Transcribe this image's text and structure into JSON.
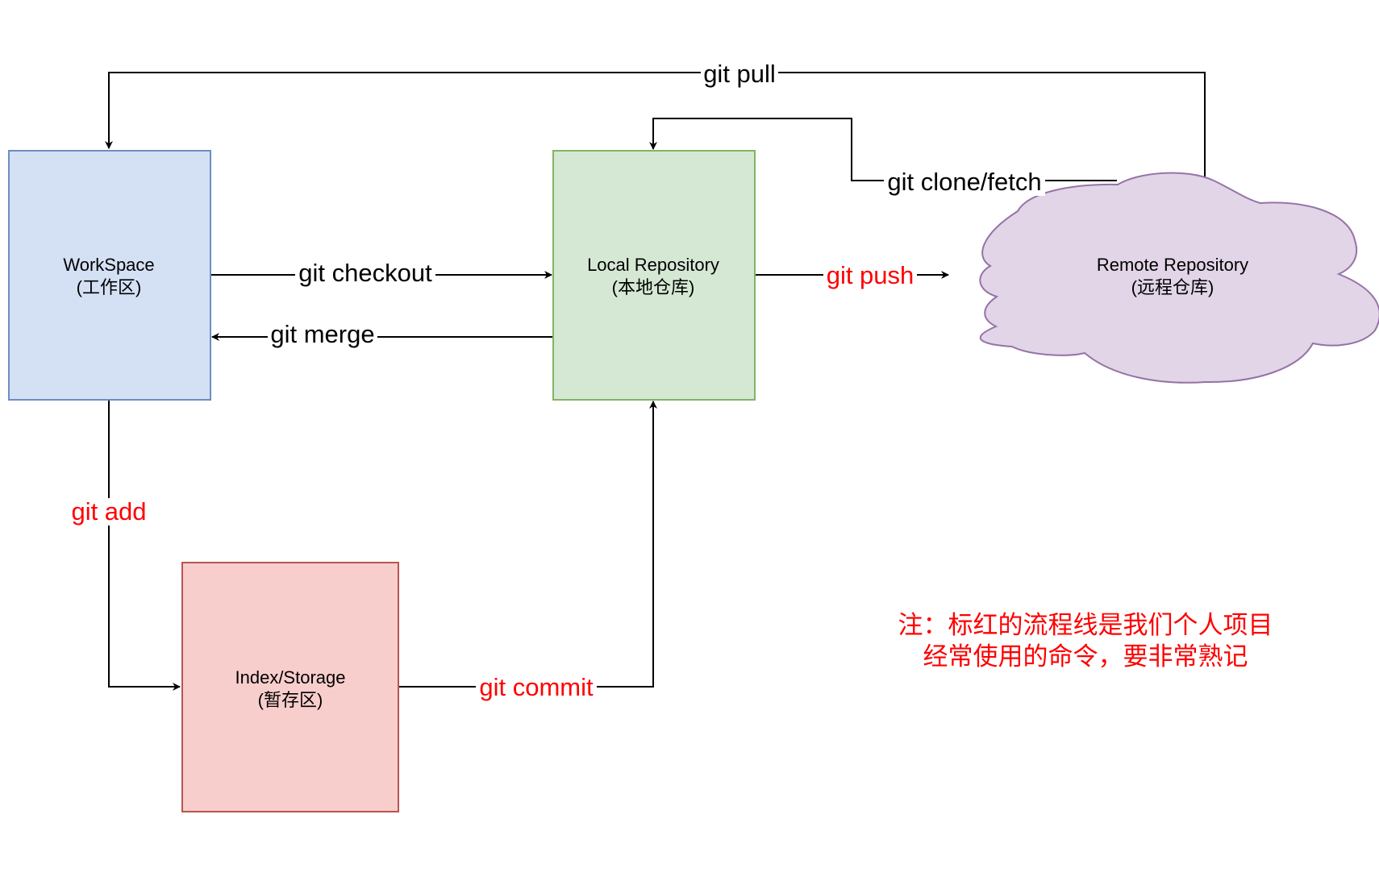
{
  "colors": {
    "workspace_fill": "#d4e1f5",
    "workspace_stroke": "#6c8ebf",
    "local_fill": "#d5e8d4",
    "local_stroke": "#82b366",
    "remote_fill": "#e1d5e7",
    "remote_stroke": "#9673a6",
    "index_fill": "#f8cecc",
    "index_stroke": "#b85450",
    "highlight_red": "#ff0000",
    "line_black": "#000000"
  },
  "nodes": {
    "workspace": {
      "line1": "WorkSpace",
      "line2": "(工作区)"
    },
    "local": {
      "line1": "Local Repository",
      "line2": "(本地仓库)"
    },
    "remote": {
      "line1": "Remote Repository",
      "line2": "(远程仓库)"
    },
    "index": {
      "line1": "Index/Storage",
      "line2": "(暂存区)"
    }
  },
  "edges": {
    "pull": "git pull",
    "clone_fetch": "git clone/fetch",
    "checkout": "git checkout",
    "merge": "git merge",
    "push": "git push",
    "add": "git add",
    "commit": "git commit"
  },
  "note": {
    "line1": "注：标红的流程线是我们个人项目",
    "line2": "经常使用的命令，要非常熟记"
  }
}
